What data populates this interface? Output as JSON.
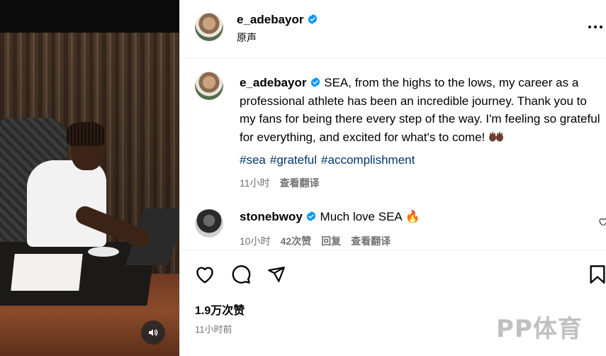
{
  "post": {
    "owner_username": "e_adebayor",
    "audio_label": "原声",
    "caption_username": "e_adebayor",
    "caption_text": "SEA, from the highs to the lows, my career as a professional athlete has been an incredible journey. Thank you to my fans for being there every step of the way. I'm feeling so grateful for everything, and excited for what's to come!",
    "caption_emoji": "hands-up-emoji",
    "hashtags": [
      "#sea",
      "#grateful",
      "#accomplishment"
    ],
    "caption_time": "11小时",
    "caption_translate": "查看翻译",
    "likes_count": "1.9万次赞",
    "posted_time": "11小时前"
  },
  "comment": {
    "username": "stonebwoy",
    "text": "Much love SEA",
    "emoji": "🔥",
    "time": "10小时",
    "likes": "42次赞",
    "reply": "回复",
    "translate": "查看翻译"
  },
  "actions": {
    "like_icon": "heart-icon",
    "comment_icon": "comment-icon",
    "share_icon": "share-icon",
    "save_icon": "bookmark-icon"
  },
  "media": {
    "sound_icon": "speaker-icon"
  },
  "watermark": "PP体育",
  "colors": {
    "verified": "#0095f6",
    "link": "#00376b",
    "secondary_text": "#737373"
  }
}
